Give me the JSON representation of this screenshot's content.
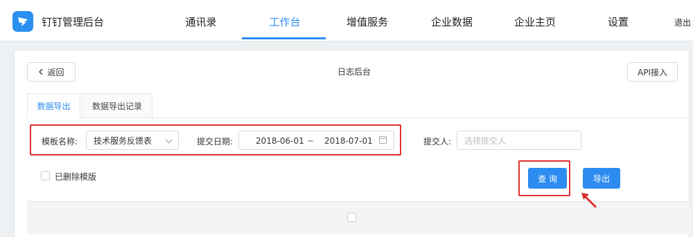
{
  "header": {
    "brand": "钉钉管理后台",
    "nav": [
      "通讯录",
      "工作台",
      "增值服务",
      "企业数据",
      "企业主页",
      "设置"
    ],
    "active_nav": "工作台",
    "logout": "退出"
  },
  "page": {
    "back_label": "返回",
    "title": "日志后台",
    "api_label": "API接入"
  },
  "tabs": [
    {
      "label": "数据导出",
      "active": true
    },
    {
      "label": "数据导出记录",
      "active": false
    }
  ],
  "filters": {
    "template_label": "模板名称:",
    "template_value": "技术服务反馈表",
    "date_label": "提交日期:",
    "date_start": "2018-06-01",
    "date_separator": "~",
    "date_end": "2018-07-01",
    "submitter_label": "提交人:",
    "submitter_placeholder": "选择提交人",
    "deleted_templates_label": "已删除模版"
  },
  "actions": {
    "query_label": "查 询",
    "export_label": "导出"
  },
  "colors": {
    "accent": "#2d8cf0",
    "highlight": "#e0302c"
  },
  "icons": {
    "logo": "dingtalk-logo-icon",
    "back": "chevron-left-icon",
    "dropdown": "chevron-down-icon",
    "calendar": "calendar-icon"
  }
}
